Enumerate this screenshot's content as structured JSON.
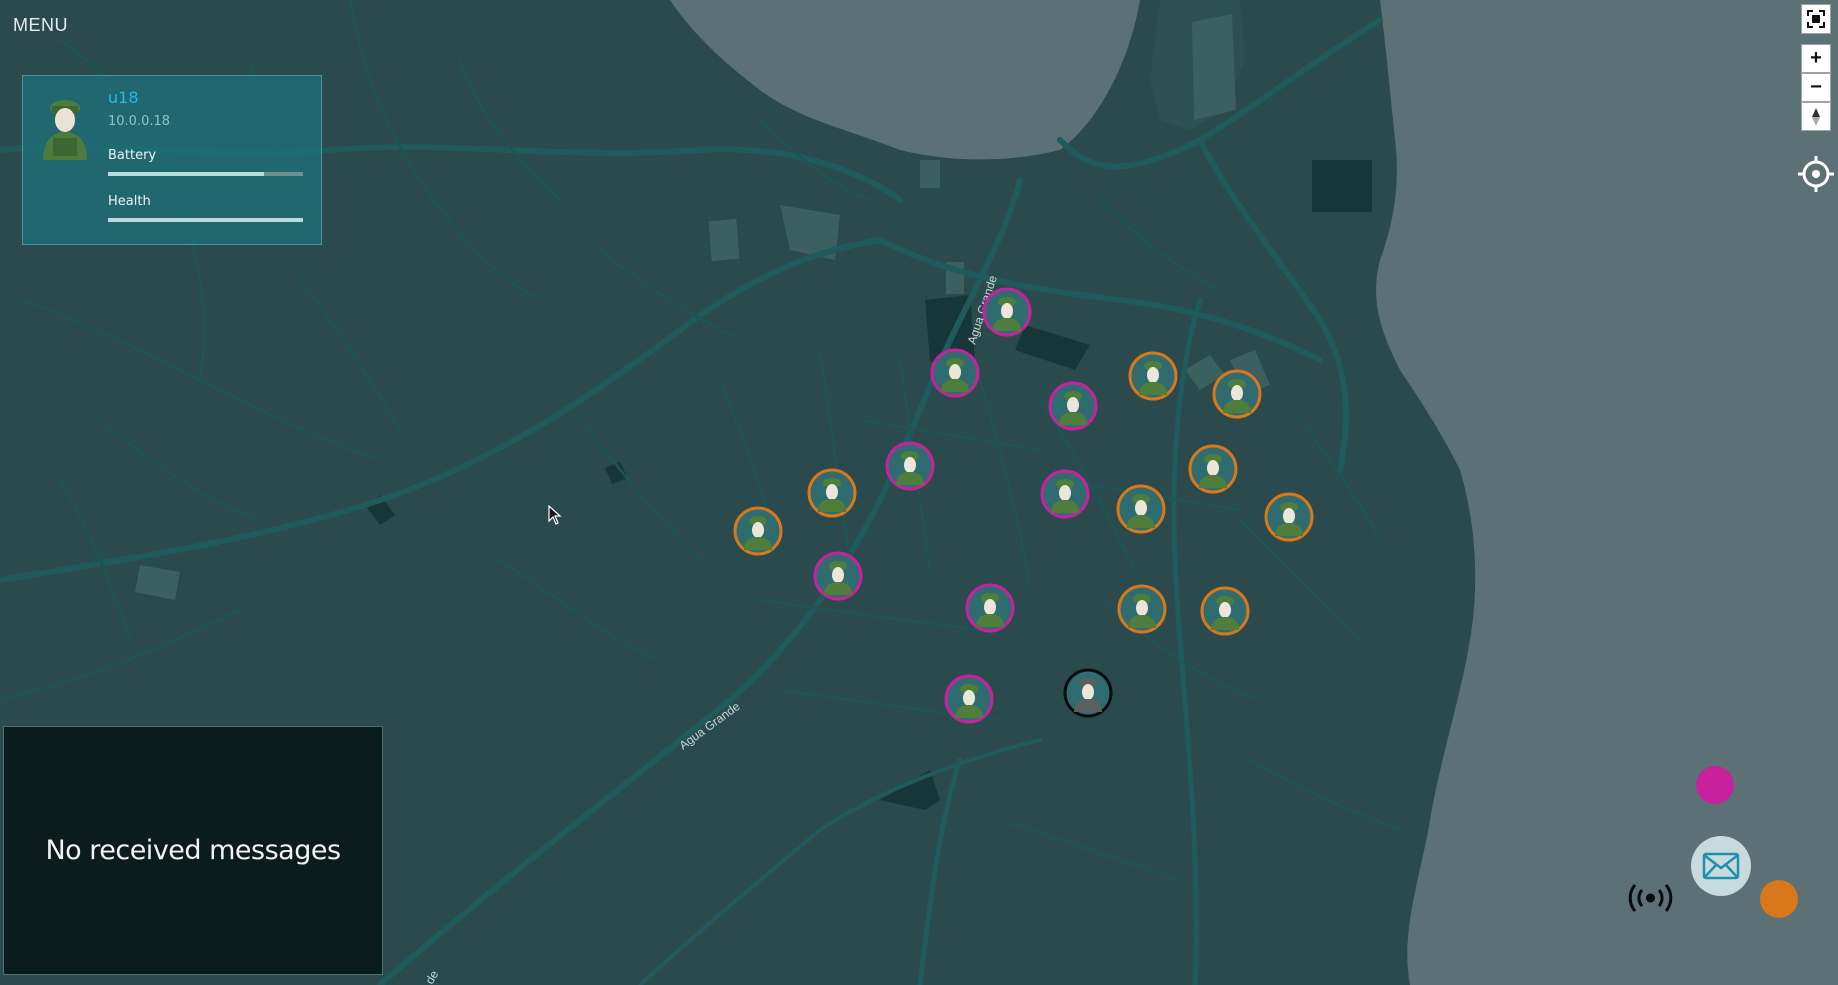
{
  "menu": {
    "label": "MENU"
  },
  "unit": {
    "name": "u18",
    "ip": "10.0.0.18",
    "battery_label": "Battery",
    "battery_level": 0.8,
    "health_label": "Health",
    "health_level": 1.0
  },
  "messages": {
    "empty_text": "No received messages"
  },
  "map": {
    "road_labels": [
      "Agua Grande",
      "Agua Grande",
      "de"
    ],
    "colors": {
      "land": "#2a4a4d",
      "water": "#5b7175",
      "road": "#20595b",
      "team_magenta": "#c8219e",
      "team_orange": "#d9771a"
    }
  },
  "markers": [
    {
      "team": "magenta",
      "icon": "soldier-icon"
    },
    {
      "team": "magenta",
      "icon": "soldier-icon"
    },
    {
      "team": "magenta",
      "icon": "soldier-icon"
    },
    {
      "team": "magenta",
      "icon": "soldier-icon"
    },
    {
      "team": "magenta",
      "icon": "soldier-icon"
    },
    {
      "team": "magenta",
      "icon": "soldier-icon"
    },
    {
      "team": "magenta",
      "icon": "soldier-icon"
    },
    {
      "team": "magenta",
      "icon": "soldier-icon"
    },
    {
      "team": "orange",
      "icon": "soldier-icon"
    },
    {
      "team": "orange",
      "icon": "soldier-icon"
    },
    {
      "team": "orange",
      "icon": "soldier-icon"
    },
    {
      "team": "orange",
      "icon": "soldier-icon"
    },
    {
      "team": "orange",
      "icon": "soldier-icon"
    },
    {
      "team": "orange",
      "icon": "soldier-icon"
    },
    {
      "team": "orange",
      "icon": "soldier-icon"
    },
    {
      "team": "orange",
      "icon": "soldier-icon"
    },
    {
      "team": "orange",
      "icon": "soldier-icon"
    },
    {
      "team": "self",
      "icon": "soldier-dark-icon"
    }
  ],
  "controls": {
    "fullscreen_icon": "fullscreen-icon",
    "zoom_in_label": "+",
    "zoom_out_label": "−",
    "compass_icon": "compass-reset-icon",
    "locate_icon": "crosshair-icon",
    "radio_icon": "radio-broadcast-icon",
    "mail_icon": "mail-icon"
  }
}
